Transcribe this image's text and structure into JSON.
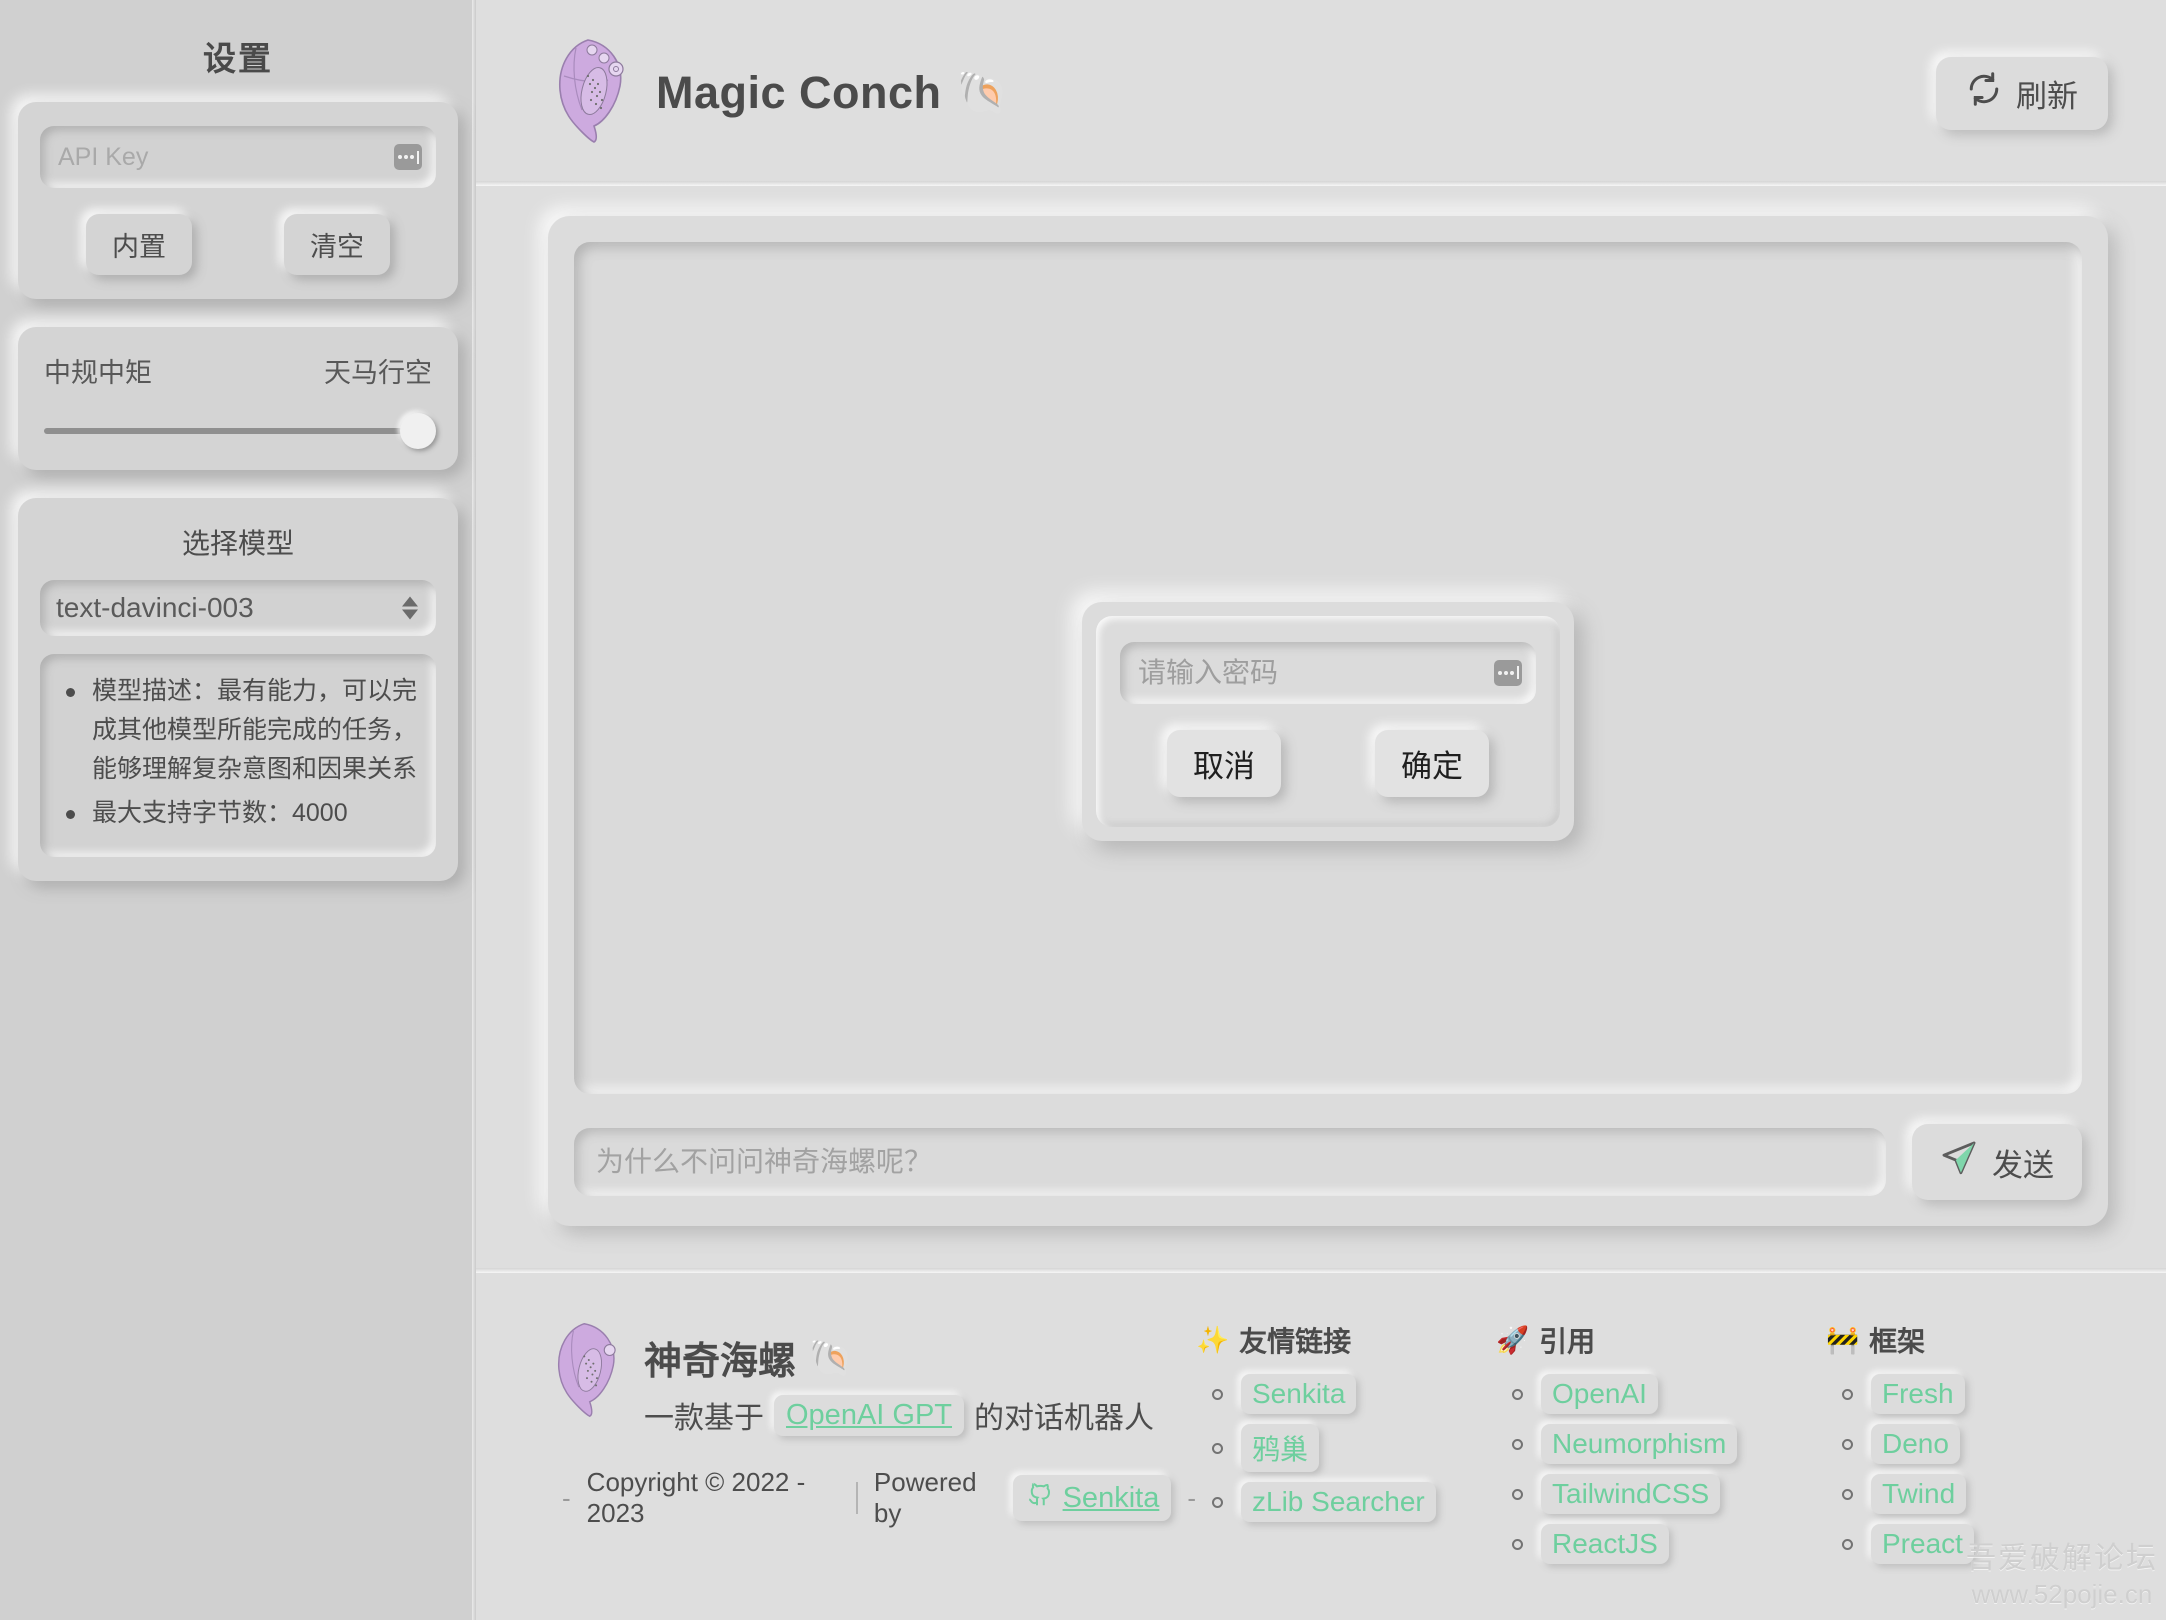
{
  "colors": {
    "background": "#d2d2d2",
    "sidebar_bg": "#d0d0d0",
    "main_bg": "#dedede",
    "accent_green": "#6ecf9e",
    "text": "#4d4d4d",
    "shell_purple": "#c9a8dc"
  },
  "sidebar": {
    "title": "设置",
    "api_key": {
      "placeholder": "API Key",
      "value": "",
      "toggle_icon": "password-dots-icon",
      "buttons": [
        {
          "label": "内置",
          "name": "builtin-key-button"
        },
        {
          "label": "清空",
          "name": "clear-key-button"
        }
      ]
    },
    "temperature": {
      "label_left": "中规中矩",
      "label_right": "天马行空",
      "value": 100,
      "min": 0,
      "max": 100
    },
    "model": {
      "title": "选择模型",
      "selected": "text-davinci-003",
      "options": [
        "text-davinci-003"
      ],
      "description_items": [
        "模型描述：最有能力，可以完成其他模型所能完成的任务，能够理解复杂意图和因果关系",
        "最大支持字节数：4000"
      ]
    }
  },
  "header": {
    "logo_icon": "conch-shell-logo",
    "title": "Magic Conch",
    "title_emoji": "🐚",
    "refresh": {
      "label": "刷新",
      "icon": "refresh-icon"
    }
  },
  "chat": {
    "messages": [],
    "side_icon": "paper-plane-icon",
    "composer": {
      "placeholder": "为什么不问问神奇海螺呢？",
      "value": "",
      "send_label": "发送",
      "send_icon": "paper-plane-icon"
    }
  },
  "modal": {
    "password_placeholder": "请输入密码",
    "password_value": "",
    "toggle_icon": "password-dots-icon",
    "cancel_label": "取消",
    "confirm_label": "确定"
  },
  "footer": {
    "brand": {
      "logo_icon": "conch-shell-logo",
      "name": "神奇海螺",
      "name_emoji": "🐚",
      "tagline_prefix": "一款基于",
      "tagline_chip": "OpenAI GPT",
      "tagline_suffix": "的对话机器人"
    },
    "copyright": {
      "dash_left": "-",
      "text": "Copyright © 2022 - 2023",
      "powered_by": "Powered by",
      "author": "Senkita",
      "author_icon": "github-icon",
      "dash_right": "-"
    },
    "columns": [
      {
        "icon": "sparkles-icon",
        "icon_glyph": "✨",
        "title": "友情链接",
        "links": [
          "Senkita",
          "鸦巢",
          "zLib Searcher"
        ]
      },
      {
        "icon": "rocket-icon",
        "icon_glyph": "🚀",
        "title": "引用",
        "links": [
          "OpenAI",
          "Neumorphism",
          "TailwindCSS",
          "ReactJS"
        ]
      },
      {
        "icon": "construction-icon",
        "icon_glyph": "🚧",
        "title": "框架",
        "links": [
          "Fresh",
          "Deno",
          "Twind",
          "Preact"
        ]
      }
    ]
  },
  "watermark": {
    "line1": "吾爱破解论坛",
    "line2": "www.52pojie.cn"
  }
}
